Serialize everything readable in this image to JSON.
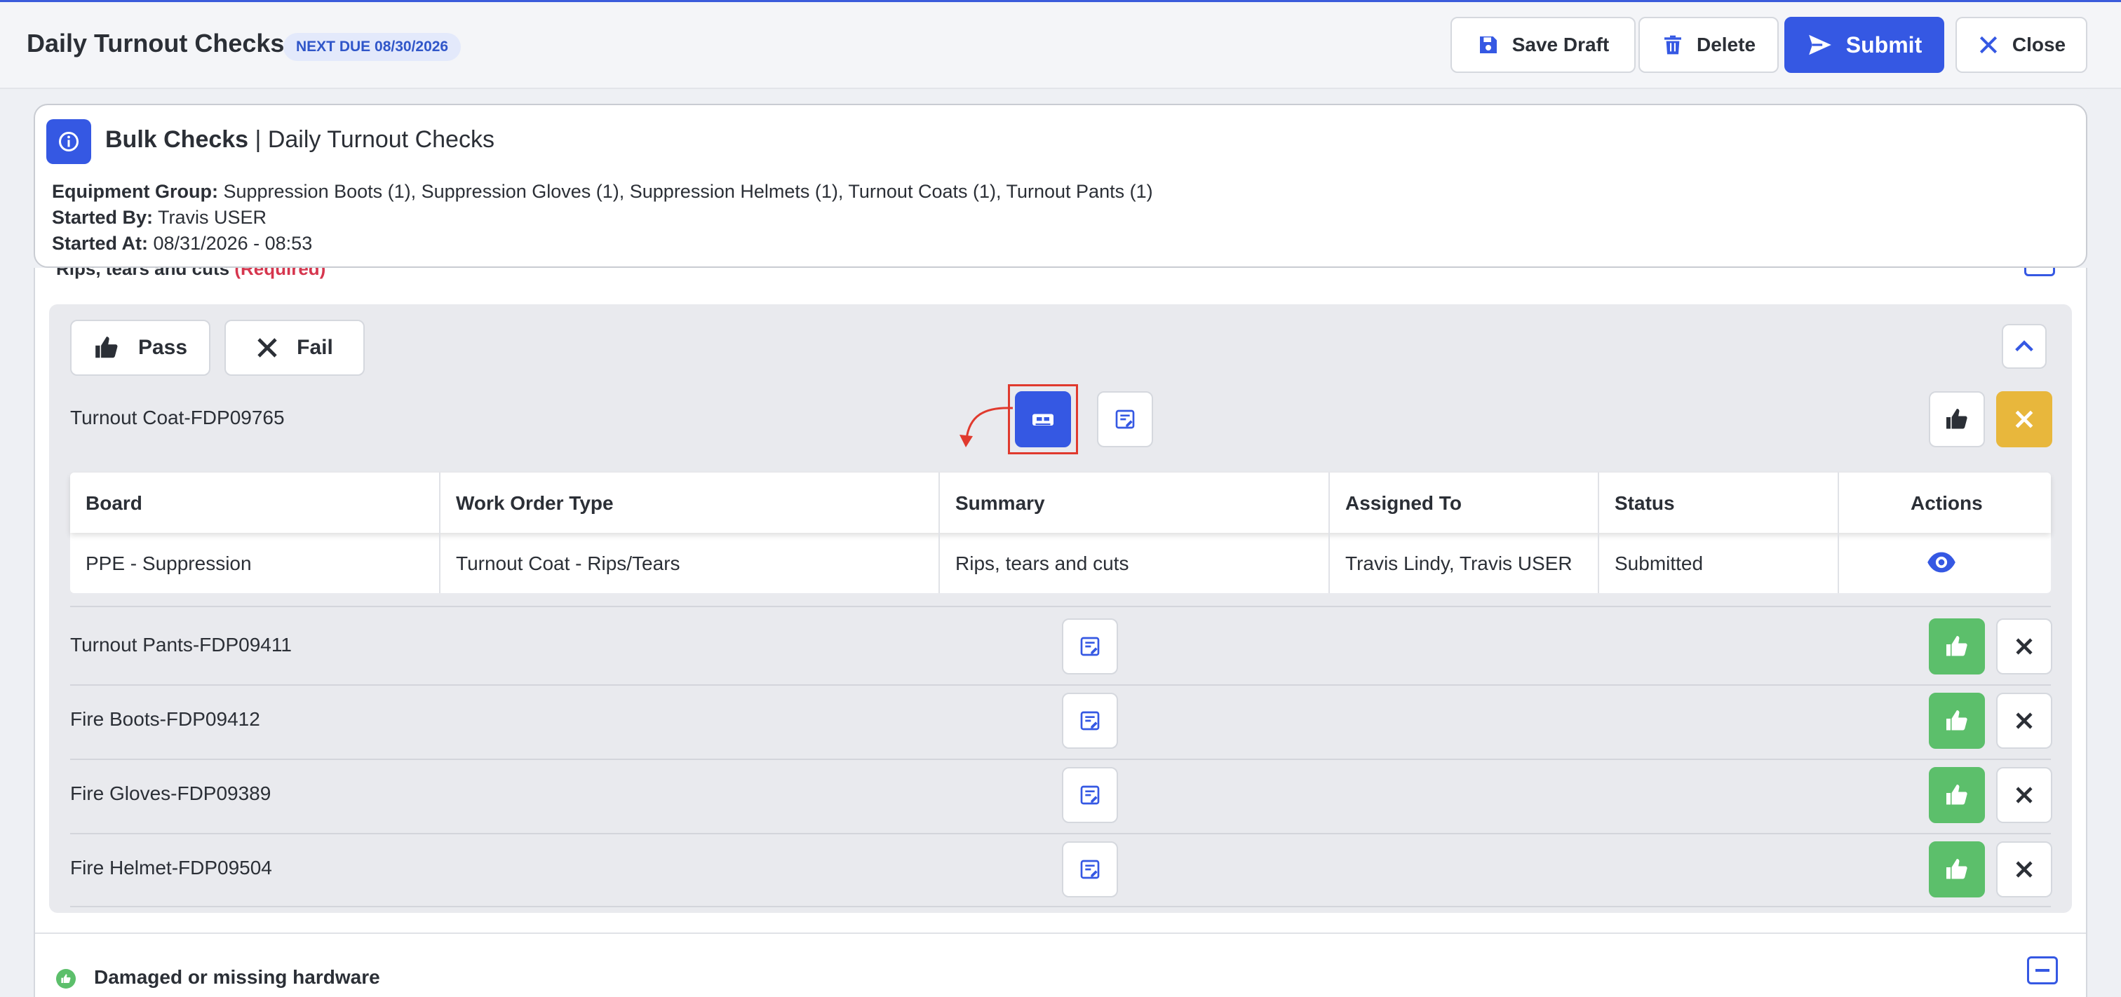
{
  "header": {
    "title": "Daily Turnout Checks",
    "due_badge": "NEXT DUE 08/30/2026",
    "save_draft": "Save Draft",
    "delete": "Delete",
    "submit": "Submit",
    "close": "Close"
  },
  "info": {
    "title_bold": "Bulk Checks",
    "title_rest": " | Daily Turnout Checks",
    "equipment_group_label": "Equipment Group:",
    "equipment_group_value": " Suppression Boots (1), Suppression Gloves (1), Suppression Helmets (1), Turnout Coats (1), Turnout Pants (1)",
    "started_by_label": "Started By:",
    "started_by_value": " Travis USER",
    "started_at_label": "Started At:",
    "started_at_value": " 08/31/2026 - 08:53"
  },
  "check": {
    "label": "Rips, tears and cuts ",
    "required": "(Required)",
    "pass_label": "Pass",
    "fail_label": "Fail"
  },
  "items": [
    {
      "name": "Turnout Coat-FDP09765",
      "status": "fail"
    },
    {
      "name": "Turnout Pants-FDP09411",
      "status": "pass"
    },
    {
      "name": "Fire Boots-FDP09412",
      "status": "pass"
    },
    {
      "name": "Fire Gloves-FDP09389",
      "status": "pass"
    },
    {
      "name": "Fire Helmet-FDP09504",
      "status": "pass"
    }
  ],
  "work_orders": {
    "columns": [
      "Board",
      "Work Order Type",
      "Summary",
      "Assigned To",
      "Status",
      "Actions"
    ],
    "rows": [
      {
        "board": "PPE - Suppression",
        "type": "Turnout Coat - Rips/Tears",
        "summary": "Rips, tears and cuts",
        "assigned": "Travis Lindy, Travis USER",
        "status": "Submitted"
      }
    ]
  },
  "next_check": {
    "label": "Damaged or missing hardware"
  },
  "colors": {
    "primary": "#3558e3",
    "pass": "#5cbf6b",
    "fail_active": "#e8b73c",
    "required": "#d6364e",
    "highlight": "#e03a2e"
  }
}
